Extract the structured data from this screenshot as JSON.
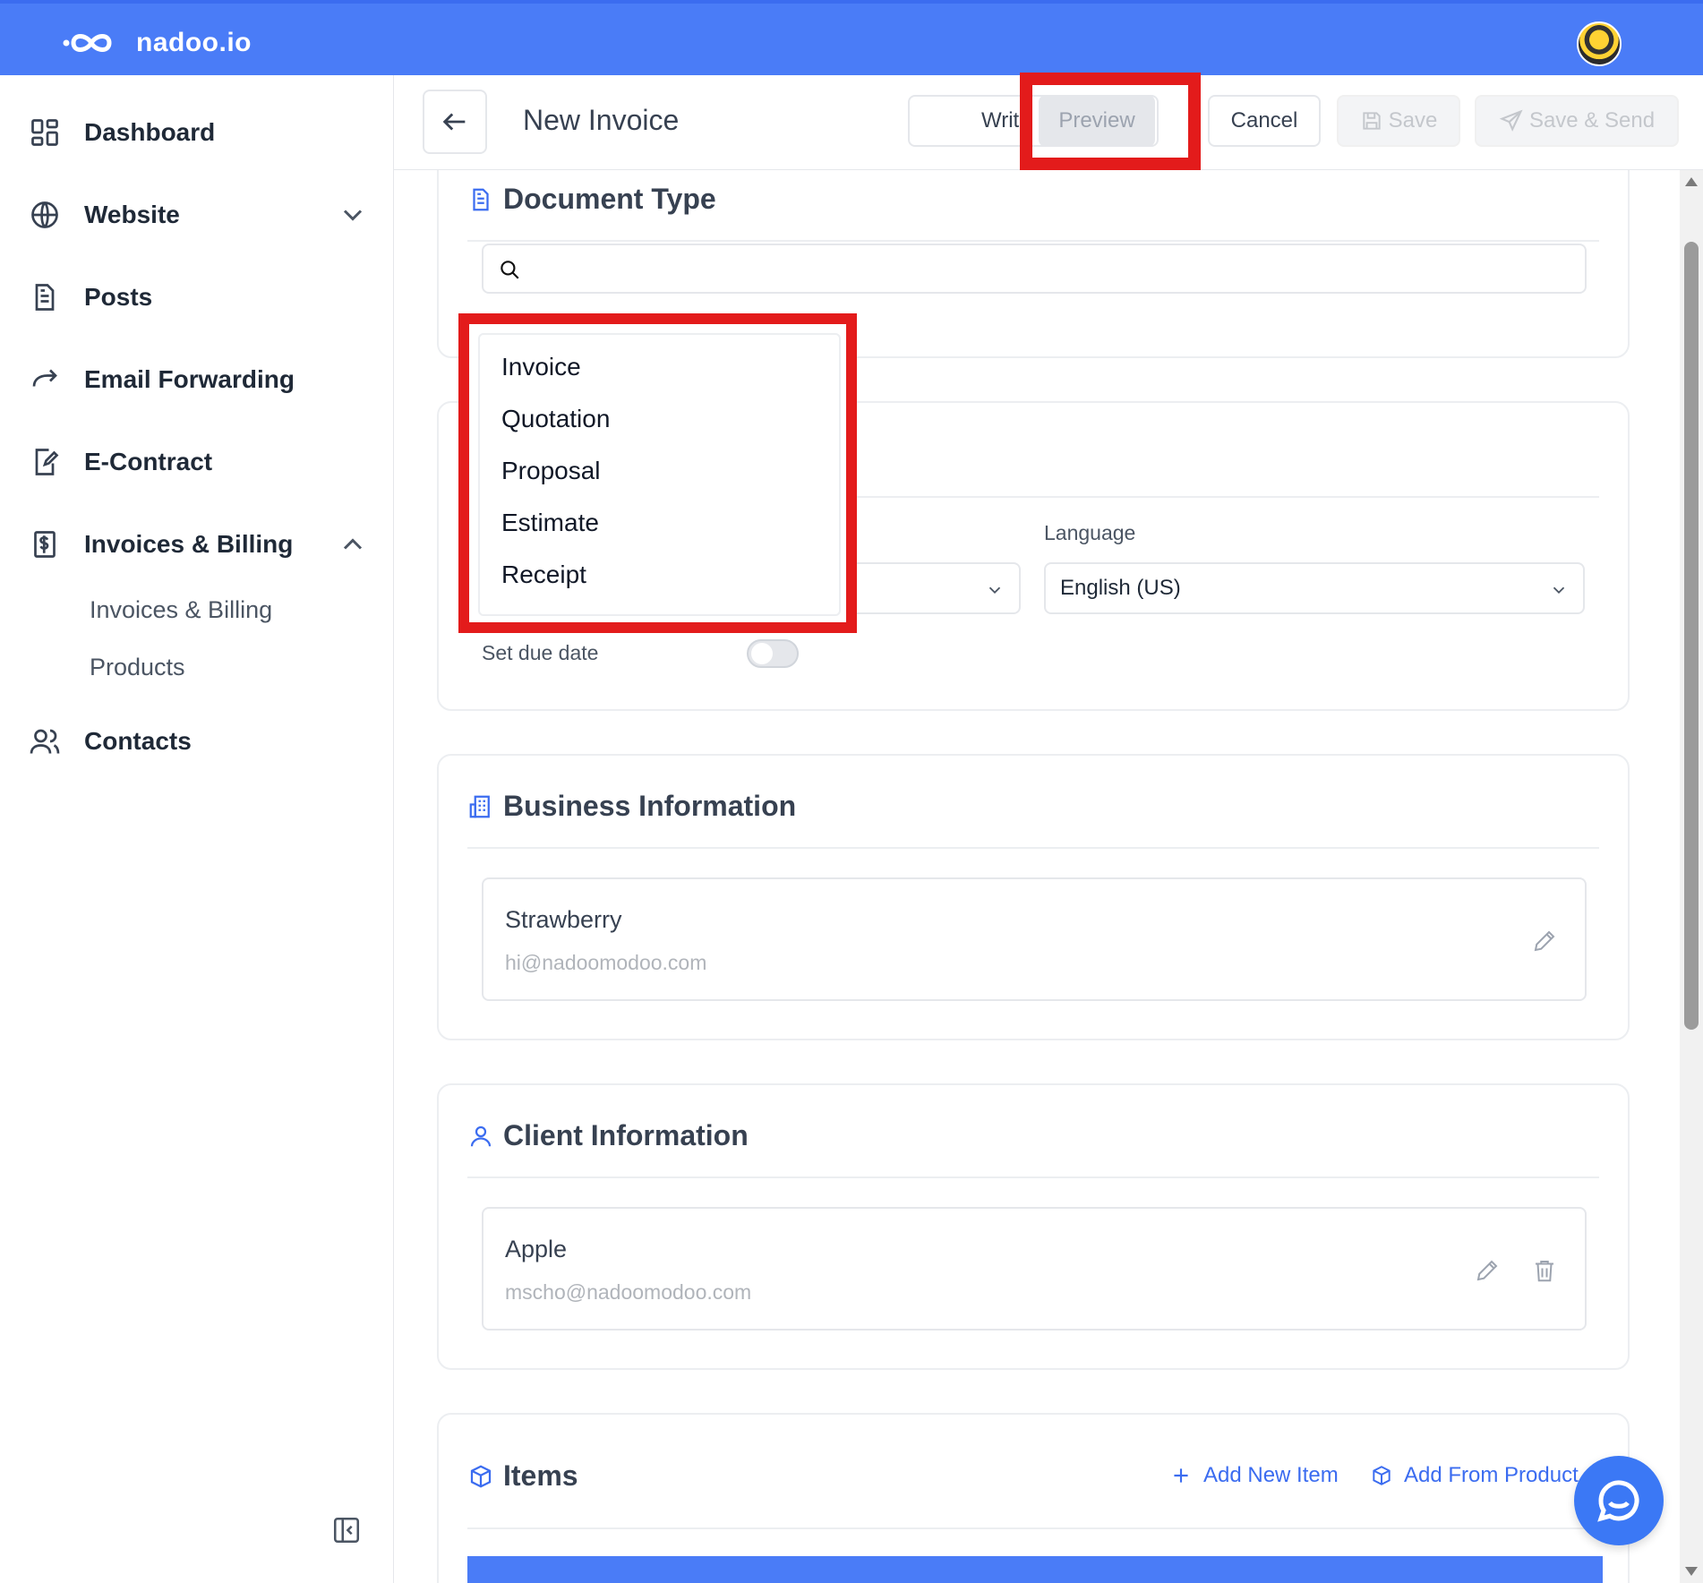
{
  "app": {
    "brand": "nadoo.io",
    "accent": "#4a7cf7",
    "highlight": "#e31b1b"
  },
  "sidebar": {
    "items": [
      {
        "label": "Dashboard",
        "icon": "grid-icon"
      },
      {
        "label": "Website",
        "icon": "globe-icon",
        "chevron": "down"
      },
      {
        "label": "Posts",
        "icon": "document-icon"
      },
      {
        "label": "Email Forwarding",
        "icon": "forward-arrow-icon"
      },
      {
        "label": "E-Contract",
        "icon": "signed-document-icon"
      },
      {
        "label": "Invoices & Billing",
        "icon": "dollar-document-icon",
        "chevron": "up"
      },
      {
        "label": "Contacts",
        "icon": "users-icon"
      }
    ],
    "sub_items": [
      {
        "label": "Invoices & Billing"
      },
      {
        "label": "Products"
      }
    ]
  },
  "header": {
    "title": "New Invoice",
    "write_label": "Write",
    "preview_label": "Preview",
    "cancel_label": "Cancel",
    "save_label": "Save",
    "save_send_label": "Save & Send"
  },
  "document_type": {
    "title": "Document Type",
    "search_value": "",
    "options": [
      "Invoice",
      "Quotation",
      "Proposal",
      "Estimate",
      "Receipt"
    ]
  },
  "settings": {
    "language_label": "Language",
    "language_value": "English (US)",
    "due_date_label": "Set due date",
    "due_date_enabled": false
  },
  "business": {
    "title": "Business Information",
    "name": "Strawberry",
    "email": "hi@nadoomodoo.com"
  },
  "client": {
    "title": "Client Information",
    "name": "Apple",
    "email": "mscho@nadoomodoo.com"
  },
  "items": {
    "title": "Items",
    "add_new_label": "Add New Item",
    "add_from_product_label": "Add From Product"
  }
}
